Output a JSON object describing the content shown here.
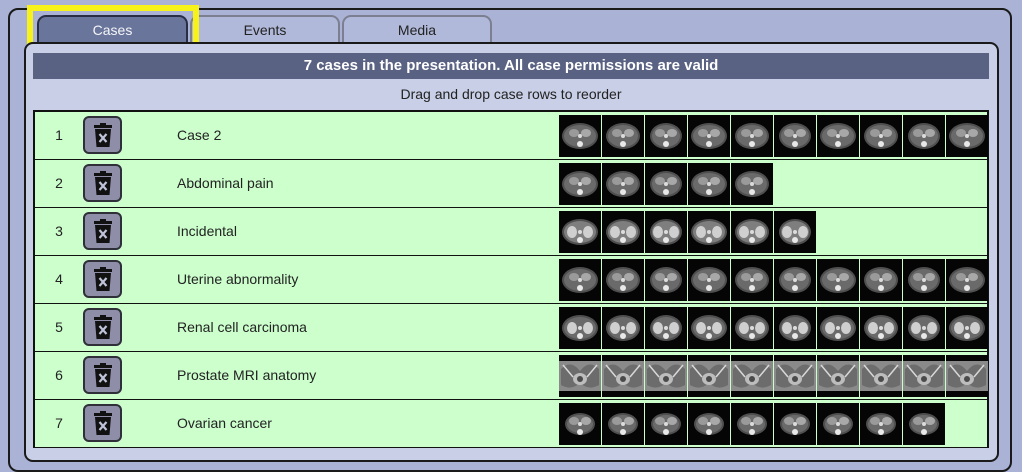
{
  "tabs": [
    {
      "label": "Cases",
      "active": true
    },
    {
      "label": "Events",
      "active": false
    },
    {
      "label": "Media",
      "active": false
    }
  ],
  "banner": "7 cases in the presentation. All case permissions are valid",
  "instruction": "Drag and drop case rows to reorder",
  "colors": {
    "page_background": "#aab3d6",
    "banner_background": "#5a6283",
    "row_background": "#ccffcc",
    "tab_active": "#69759a",
    "highlight_outline": "#f6f21a"
  },
  "row_icon": "trash-delete-icon",
  "cases": [
    {
      "number": "1",
      "title": "Case 2",
      "thumbnail_count": 10,
      "thumbnail_kind": "ct-abdomen"
    },
    {
      "number": "2",
      "title": "Abdominal pain",
      "thumbnail_count": 5,
      "thumbnail_kind": "ct-abdomen"
    },
    {
      "number": "3",
      "title": "Incidental",
      "thumbnail_count": 6,
      "thumbnail_kind": "ct-abdomen-contrast"
    },
    {
      "number": "4",
      "title": "Uterine abnormality",
      "thumbnail_count": 10,
      "thumbnail_kind": "ct-abdomen"
    },
    {
      "number": "5",
      "title": "Renal cell carcinoma",
      "thumbnail_count": 10,
      "thumbnail_kind": "ct-kidney"
    },
    {
      "number": "6",
      "title": "Prostate MRI anatomy",
      "thumbnail_count": 10,
      "thumbnail_kind": "mri-pelvis"
    },
    {
      "number": "7",
      "title": "Ovarian cancer",
      "thumbnail_count": 9,
      "thumbnail_kind": "ct-pelvis"
    }
  ]
}
